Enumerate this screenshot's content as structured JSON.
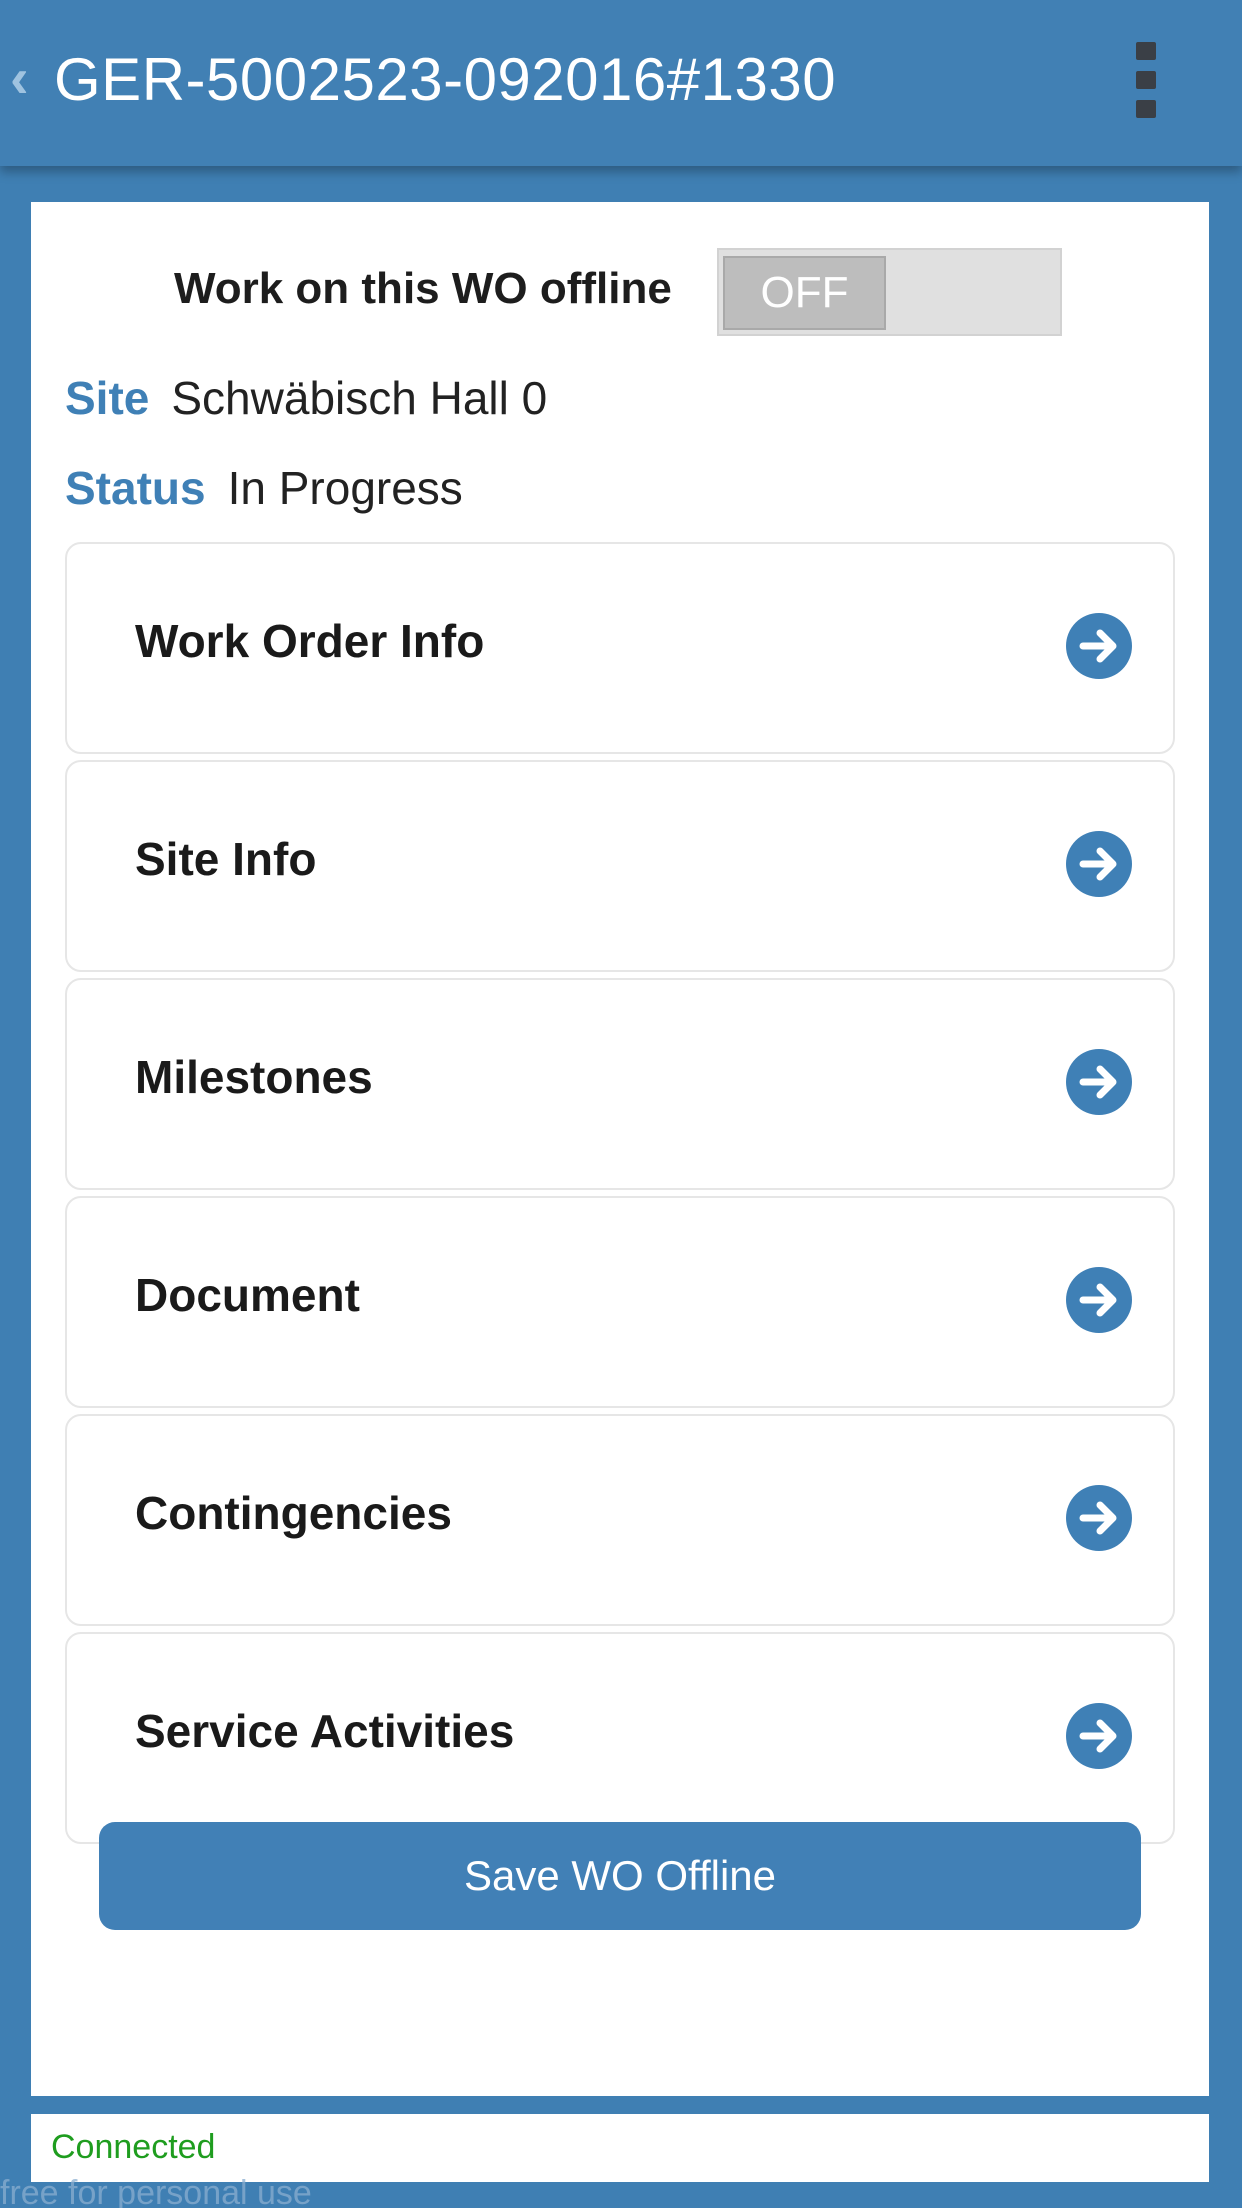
{
  "header": {
    "back_icon": "chevron-left-icon",
    "title": "GER-5002523-092016#1330",
    "menu_icon": "overflow-menu-icon"
  },
  "offline": {
    "label": "Work on this WO offline",
    "toggle_state": "OFF"
  },
  "details": {
    "site_label": "Site",
    "site_value": "Schwäbisch Hall 0",
    "status_label": "Status",
    "status_value": "In Progress"
  },
  "menu": {
    "items": [
      {
        "label": "Work Order Info",
        "icon": "arrow-right-circle-icon"
      },
      {
        "label": "Site Info",
        "icon": "arrow-right-circle-icon"
      },
      {
        "label": "Milestones",
        "icon": "arrow-right-circle-icon"
      },
      {
        "label": "Document",
        "icon": "arrow-right-circle-icon"
      },
      {
        "label": "Contingencies",
        "icon": "arrow-right-circle-icon"
      },
      {
        "label": "Service Activities",
        "icon": "arrow-right-circle-icon"
      }
    ]
  },
  "actions": {
    "save_label": "Save WO Offline"
  },
  "connection": {
    "status": "Connected"
  },
  "watermark": "free for personal use",
  "colors": {
    "brand_blue": "#4180b4",
    "accent_blue": "#3f80b6",
    "connected_green": "#1f9d1f"
  }
}
